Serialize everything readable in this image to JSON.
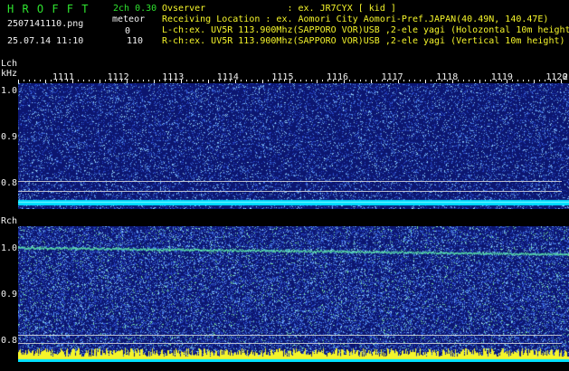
{
  "header": {
    "logo": "H R O F F T",
    "mode": "2ch 0.30",
    "filename": "2507141110.png",
    "meteor_label": "meteor",
    "datetime": "25.07.14 11:10",
    "lch_count": "0",
    "rch_count": "110",
    "observer_line": "Ovserver               : ex. JR7CYX [ kid ]",
    "location_line": "Receiving Location : ex. Aomori City Aomori-Pref.JAPAN(40.49N, 140.47E)",
    "lch_line": "L-ch:ex. UV5R 113.900Mhz(SAPPORO VOR)USB ,2-ele yagi (Holozontal 10m height)",
    "rch_line": "R-ch:ex. UV5R 113.900Mhz(SAPPORO VOR)USB ,2-ele yagi (Vertical 10m height)"
  },
  "lch": {
    "label": "Lch",
    "unit": "kHz",
    "y_labels": [
      "1.0",
      "0.9",
      "0.8"
    ]
  },
  "rch": {
    "label": "Rch",
    "y_labels": [
      "1.0",
      "0.9",
      "0.8"
    ]
  },
  "time_axis": {
    "labels": [
      "1111",
      "1112",
      "1113",
      "1114",
      "1115",
      "1116",
      "1117",
      "1118",
      "1119",
      "1120"
    ],
    "edge_label": "2"
  },
  "colors": {
    "background": "#000000",
    "header_green": "#2fe22f",
    "text_white": "#f2f2f2",
    "noise_blue": "#1a2f8f",
    "baseline_cyan": "#00e5ff",
    "meteor_yellow": "#f5f52a"
  }
}
